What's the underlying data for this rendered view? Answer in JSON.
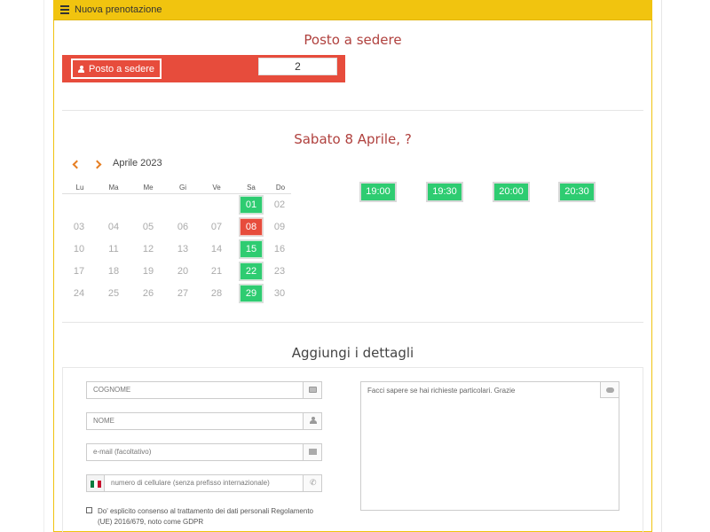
{
  "header": {
    "title": "Nuova prenotazione",
    "icon": "list-icon"
  },
  "seat": {
    "title": "Posto a sedere",
    "button_label": "Posto a sedere",
    "count": "2"
  },
  "date_section": {
    "title": "Sabato 8 Aprile, ?"
  },
  "calendar": {
    "month": "Aprile 2023",
    "weekdays": [
      "Lu",
      "Ma",
      "Me",
      "Gi",
      "Ve",
      "Sa",
      "Do"
    ],
    "weeks": [
      [
        "",
        "",
        "",
        "",
        "",
        "01",
        "02"
      ],
      [
        "03",
        "04",
        "05",
        "06",
        "07",
        "08",
        "09"
      ],
      [
        "10",
        "11",
        "12",
        "13",
        "14",
        "15",
        "16"
      ],
      [
        "17",
        "18",
        "19",
        "20",
        "21",
        "22",
        "23"
      ],
      [
        "24",
        "25",
        "26",
        "27",
        "28",
        "29",
        "30"
      ]
    ],
    "available_days": [
      "01",
      "15",
      "22",
      "29"
    ],
    "selected_day": "08",
    "colors": {
      "available": "#2ecc71",
      "selected": "#e74c3c"
    }
  },
  "time_slots": [
    "19:00",
    "19:30",
    "20:00",
    "20:30"
  ],
  "details": {
    "title": "Aggiungi i dettagli",
    "surname_placeholder": "COGNOME",
    "name_placeholder": "NOME",
    "email_placeholder": "e-mail (facoltativo)",
    "phone_placeholder": "numero di cellulare (senza prefisso internazionale)",
    "notes_placeholder": "Facci sapere se hai richieste particolari. Grazie",
    "consent_text": "Do' esplicito consenso al trattamento dei dati personali Regolamento (UE) 2016/679, noto come GDPR"
  },
  "colors": {
    "header": "#f1c40f",
    "accent_red": "#e74c3c",
    "title_red": "#b0413e",
    "green": "#2ecc71"
  }
}
